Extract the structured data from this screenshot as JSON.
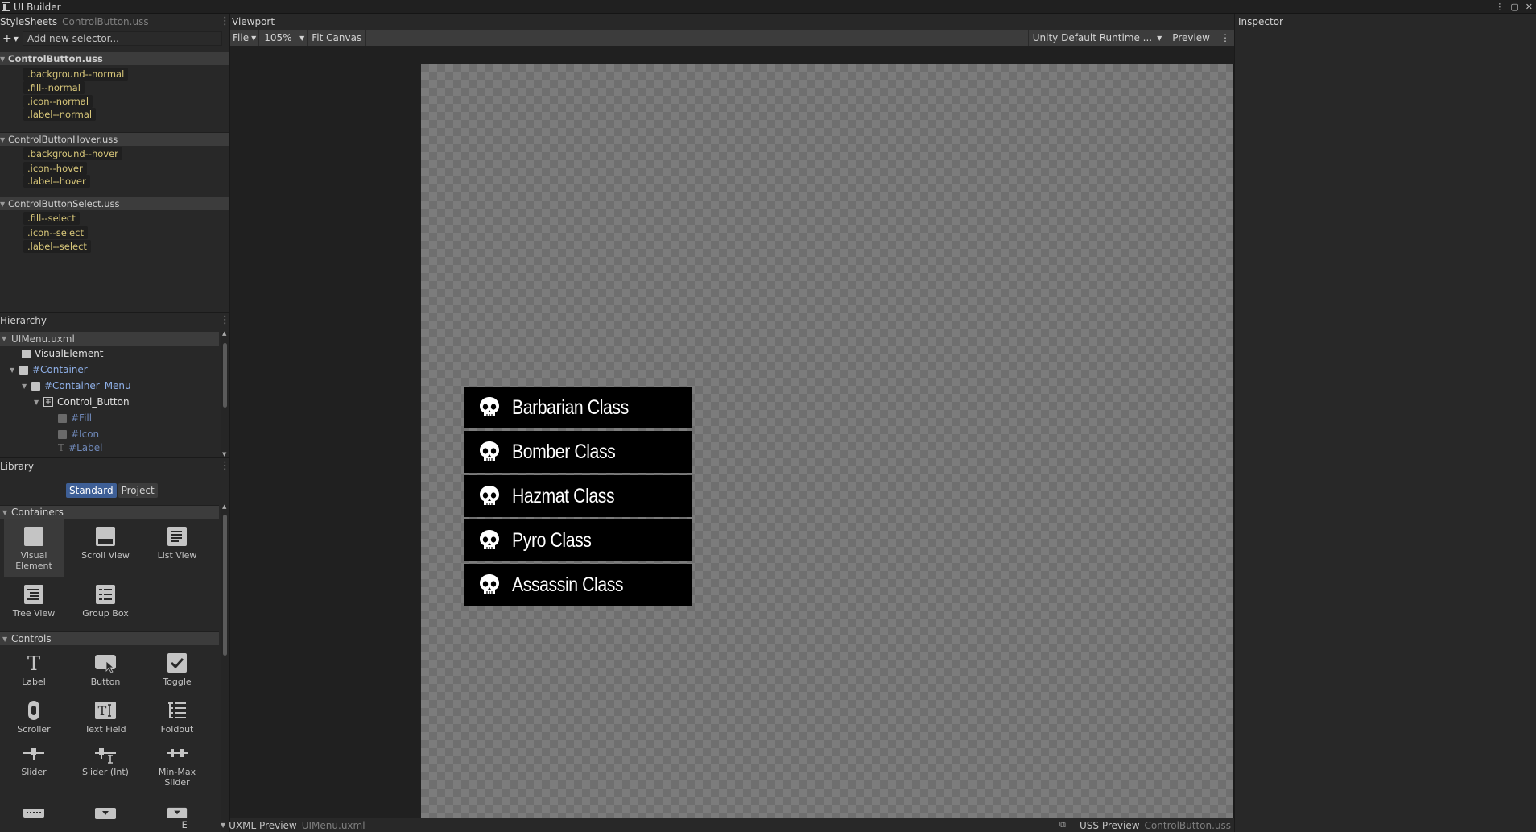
{
  "window": {
    "title": "UI Builder",
    "controls": [
      "⋮",
      "▢",
      "✕"
    ]
  },
  "stylesheets": {
    "title": "StyleSheets",
    "current": "ControlButton.uss",
    "add_selector_placeholder": "Add new selector...",
    "sheets": [
      {
        "name": "ControlButton.uss",
        "selectors": [
          ".background--normal",
          ".fill--normal",
          ".icon--normal",
          ".label--normal"
        ]
      },
      {
        "name": "ControlButtonHover.uss",
        "selectors": [
          ".background--hover",
          ".icon--hover",
          ".label--hover"
        ]
      },
      {
        "name": "ControlButtonSelect.uss",
        "selectors": [
          ".fill--select",
          ".icon--select",
          ".label--select"
        ]
      }
    ]
  },
  "hierarchy": {
    "title": "Hierarchy",
    "items": [
      {
        "label": "UIMenu.uxml"
      },
      {
        "label": "VisualElement"
      },
      {
        "label": "#Container"
      },
      {
        "label": "#Container_Menu"
      },
      {
        "label": "Control_Button"
      },
      {
        "label": "#Fill"
      },
      {
        "label": "#Icon"
      },
      {
        "label": "#Label"
      }
    ]
  },
  "library": {
    "title": "Library",
    "tabs": [
      "Standard",
      "Project"
    ],
    "containers_label": "Containers",
    "containers": [
      "Visual Element",
      "Scroll View",
      "List View",
      "Tree View",
      "Group Box"
    ],
    "controls_label": "Controls",
    "controls": [
      "Label",
      "Button",
      "Toggle",
      "Scroller",
      "Text Field",
      "Foldout",
      "Slider",
      "Slider (Int)",
      "Min-Max Slider"
    ]
  },
  "viewport": {
    "title": "Viewport",
    "file_menu": "File",
    "zoom": "105%",
    "fit_canvas": "Fit Canvas",
    "theme": "Unity Default Runtime ...",
    "preview": "Preview",
    "menu_buttons": [
      "Barbarian Class",
      "Bomber Class",
      "Hazmat Class",
      "Pyro Class",
      "Assassin Class"
    ],
    "uxml_preview": "UXML Preview",
    "uxml_file": "UIMenu.uxml",
    "uss_preview": "USS Preview",
    "uss_file": "ControlButton.uss"
  },
  "inspector": {
    "title": "Inspector"
  },
  "colors": {
    "accent_tab": "#3e5f96",
    "selector_text": "#d8c77a",
    "id_text": "#8fb0e8"
  }
}
